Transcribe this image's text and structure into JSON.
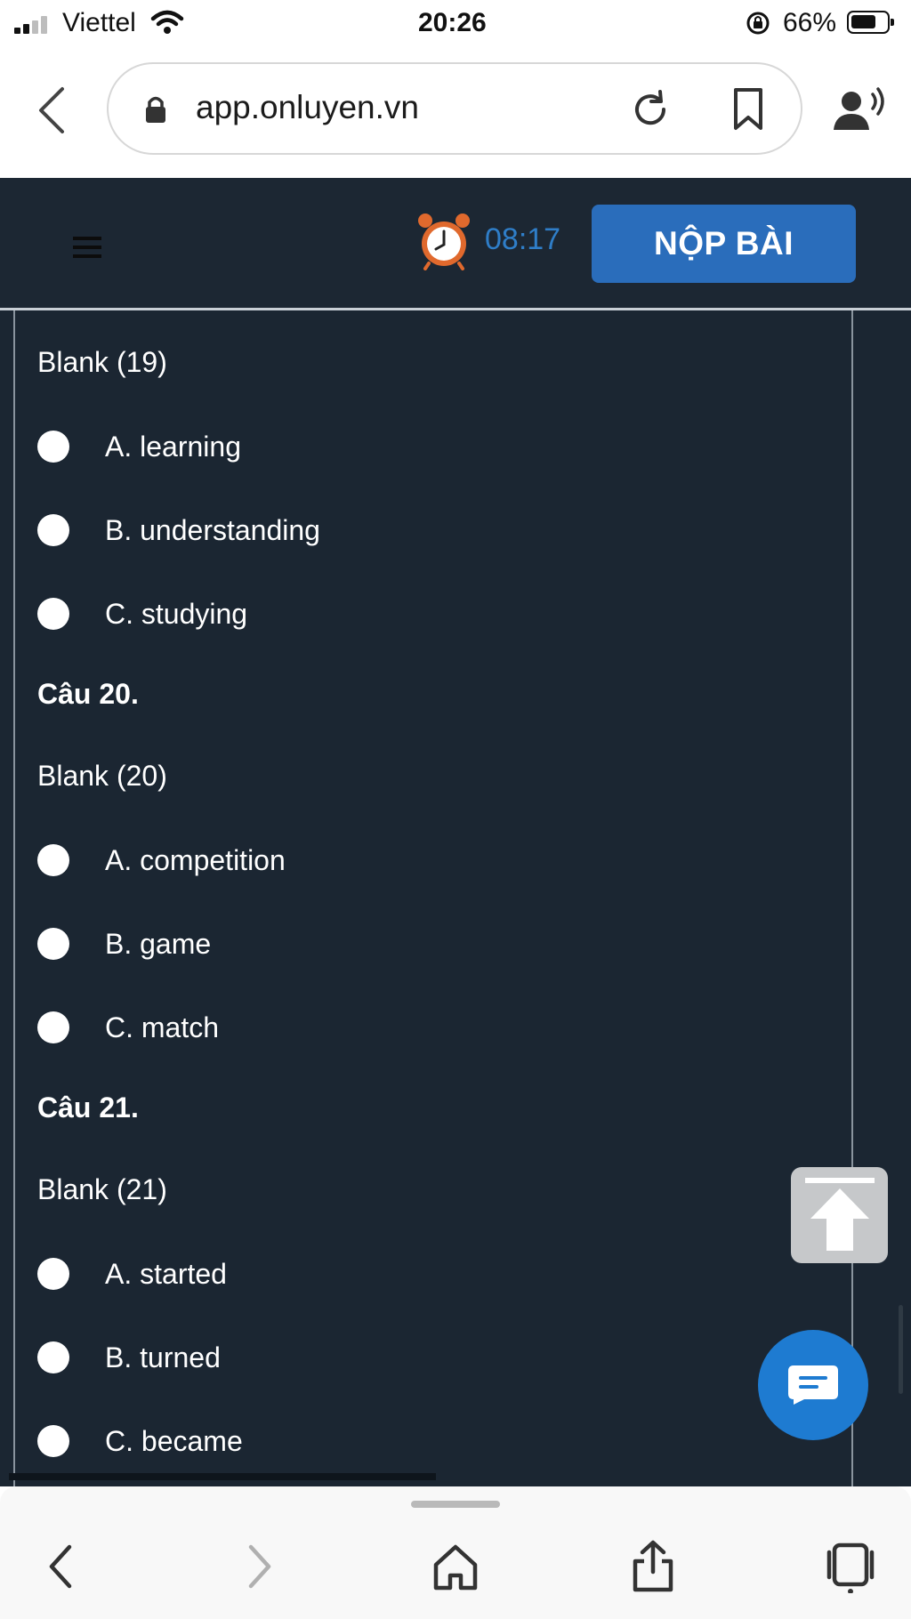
{
  "status_bar": {
    "carrier": "Viettel",
    "time": "20:26",
    "battery": "66%"
  },
  "browser": {
    "url": "app.onluyen.vn"
  },
  "header": {
    "timer": "08:17",
    "submit_label": "NỘP BÀI"
  },
  "questions": [
    {
      "title": "",
      "blank": "Blank (19)",
      "options": [
        "A. learning",
        "B. understanding",
        "C. studying"
      ]
    },
    {
      "title": "Câu 20.",
      "blank": "Blank (20)",
      "options": [
        "A. competition",
        "B. game",
        "C. match"
      ]
    },
    {
      "title": "Câu 21.",
      "blank": "Blank (21)",
      "options": [
        "A. started",
        "B. turned",
        "C. became"
      ]
    }
  ],
  "icons": {
    "menu": "hamburger-icon",
    "alarm": "alarm-clock-icon",
    "scroll_top": "arrow-up-icon",
    "chat": "chat-icon"
  },
  "colors": {
    "header_bg": "#1c2733",
    "content_bg": "#1b2632",
    "accent": "#2a6dbb",
    "timer": "#2f7ec8"
  }
}
